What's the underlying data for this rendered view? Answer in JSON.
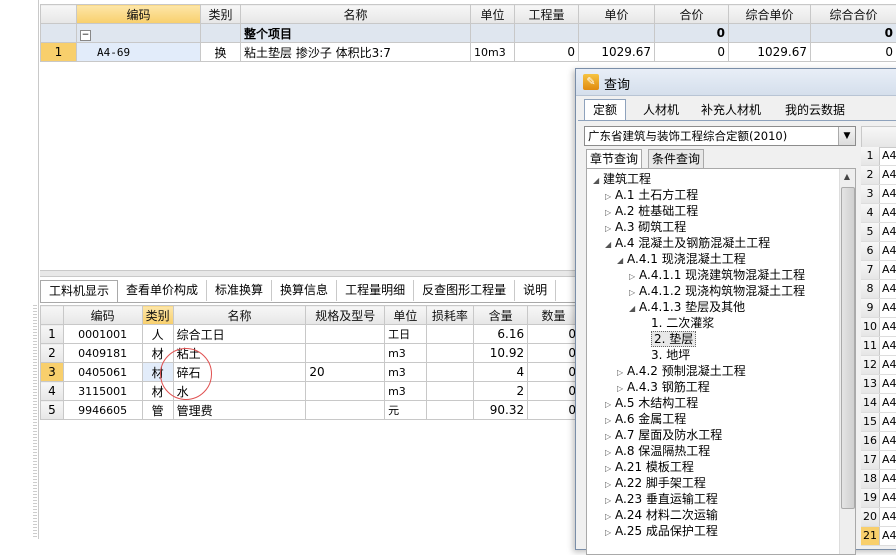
{
  "top_grid": {
    "headers": [
      "编码",
      "类别",
      "名称",
      "单位",
      "工程量",
      "单价",
      "合价",
      "综合单价",
      "综合合价"
    ],
    "group_row": {
      "name": "整个项目",
      "hejia": "0",
      "zonghe": "0"
    },
    "rows": [
      {
        "num": "1",
        "code": "A4-69",
        "type": "换",
        "name": "粘土垫层 掺沙子 体积比3:7",
        "unit": "10m3",
        "qty": "0",
        "price": "1029.67",
        "total": "0",
        "zprice": "1029.67",
        "ztotal": "0"
      }
    ]
  },
  "bottom_tabs": [
    "工料机显示",
    "查看单价构成",
    "标准换算",
    "换算信息",
    "工程量明细",
    "反查图形工程量",
    "说明"
  ],
  "bottom_grid": {
    "headers": [
      "编码",
      "类别",
      "名称",
      "规格及型号",
      "单位",
      "损耗率",
      "含量",
      "数量"
    ],
    "rows": [
      {
        "num": "1",
        "code": "0001001",
        "type": "人",
        "name": "综合工日",
        "spec": "",
        "unit": "工日",
        "loss": "",
        "content": "6.16",
        "qty": "0"
      },
      {
        "num": "2",
        "code": "0409181",
        "type": "材",
        "name": "粘土",
        "spec": "",
        "unit": "m3",
        "loss": "",
        "content": "10.92",
        "qty": "0"
      },
      {
        "num": "3",
        "code": "0405061",
        "type": "材",
        "name": "碎石",
        "spec": "20",
        "unit": "m3",
        "loss": "",
        "content": "4",
        "qty": "0"
      },
      {
        "num": "4",
        "code": "3115001",
        "type": "材",
        "name": "水",
        "spec": "",
        "unit": "m3",
        "loss": "",
        "content": "2",
        "qty": "0"
      },
      {
        "num": "5",
        "code": "9946605",
        "type": "管",
        "name": "管理费",
        "spec": "",
        "unit": "元",
        "loss": "",
        "content": "90.32",
        "qty": "0"
      }
    ]
  },
  "dialog": {
    "title": "查询",
    "tabs": [
      "定额",
      "人材机",
      "补充人材机",
      "我的云数据"
    ],
    "combo_value": "广东省建筑与装饰工程综合定额(2010)",
    "sub_tabs": [
      "章节查询",
      "条件查询"
    ],
    "tree": [
      {
        "label": "建筑工程",
        "indent": 0,
        "tri": "◢"
      },
      {
        "label": "A.1 土石方工程",
        "indent": 1,
        "tri": "▷"
      },
      {
        "label": "A.2 桩基础工程",
        "indent": 1,
        "tri": "▷"
      },
      {
        "label": "A.3 砌筑工程",
        "indent": 1,
        "tri": "▷"
      },
      {
        "label": "A.4 混凝土及钢筋混凝土工程",
        "indent": 1,
        "tri": "◢"
      },
      {
        "label": "A.4.1 现浇混凝土工程",
        "indent": 2,
        "tri": "◢"
      },
      {
        "label": "A.4.1.1 现浇建筑物混凝土工程",
        "indent": 3,
        "tri": "▷"
      },
      {
        "label": "A.4.1.2 现浇构筑物混凝土工程",
        "indent": 3,
        "tri": "▷"
      },
      {
        "label": "A.4.1.3 垫层及其他",
        "indent": 3,
        "tri": "◢"
      },
      {
        "label": "1. 二次灌浆",
        "indent": 4,
        "tri": ""
      },
      {
        "label": "2. 垫层",
        "indent": 4,
        "tri": "",
        "selected": true
      },
      {
        "label": "3. 地坪",
        "indent": 4,
        "tri": ""
      },
      {
        "label": "A.4.2 预制混凝土工程",
        "indent": 2,
        "tri": "▷"
      },
      {
        "label": "A.4.3 钢筋工程",
        "indent": 2,
        "tri": "▷"
      },
      {
        "label": "A.5 木结构工程",
        "indent": 1,
        "tri": "▷"
      },
      {
        "label": "A.6 金属工程",
        "indent": 1,
        "tri": "▷"
      },
      {
        "label": "A.7 屋面及防水工程",
        "indent": 1,
        "tri": "▷"
      },
      {
        "label": "A.8 保温隔热工程",
        "indent": 1,
        "tri": "▷"
      },
      {
        "label": "A.21 模板工程",
        "indent": 1,
        "tri": "▷"
      },
      {
        "label": "A.22 脚手架工程",
        "indent": 1,
        "tri": "▷"
      },
      {
        "label": "A.23 垂直运输工程",
        "indent": 1,
        "tri": "▷"
      },
      {
        "label": "A.24 材料二次运输",
        "indent": 1,
        "tri": "▷"
      },
      {
        "label": "A.25 成品保护工程",
        "indent": 1,
        "tri": "▷"
      }
    ],
    "right_rows": [
      "1",
      "2",
      "3",
      "4",
      "5",
      "6",
      "7",
      "8",
      "9",
      "10",
      "11",
      "12",
      "13",
      "14",
      "15",
      "16",
      "17",
      "18",
      "19",
      "20",
      "21"
    ],
    "right_vals": [
      "A4",
      "A4",
      "A4",
      "A4",
      "A4",
      "A4",
      "A4",
      "A4",
      "A4",
      "A4",
      "A4",
      "A4",
      "A4",
      "A4",
      "A4",
      "A4",
      "A4",
      "A4",
      "A4",
      "A4",
      "A4"
    ]
  }
}
